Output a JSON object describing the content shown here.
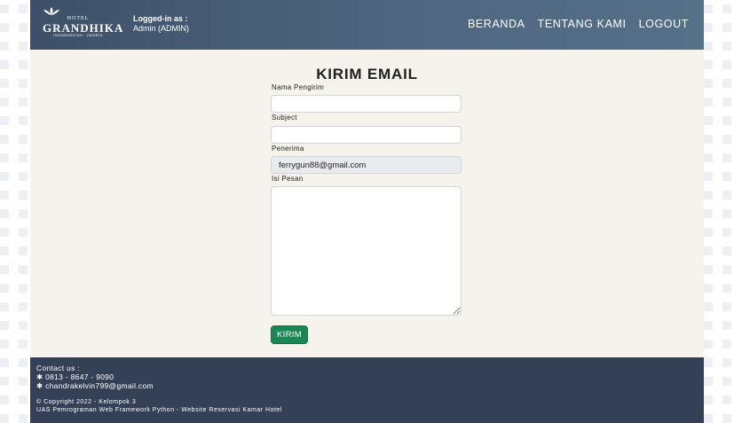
{
  "header": {
    "logo": {
      "hotel": "HOTEL",
      "name": "GRANDHIKA",
      "city": "ISKANDARSYAH · JAKARTA"
    },
    "login_label": "Logged-in as :",
    "login_user": "Admin (ADMIN)",
    "nav": [
      "BERANDA",
      "TENTANG KAMI",
      "LOGOUT"
    ]
  },
  "form": {
    "title": "KIRIM EMAIL",
    "sender_label": "Nama Pengirim",
    "sender_value": "",
    "subject_label": "Subject",
    "subject_value": "",
    "recipient_label": "Penerima",
    "recipient_value": "ferrygun88@gmail.com",
    "message_label": "Isi Pesan",
    "message_value": "",
    "submit_label": "KIRIM",
    "submit_color": "#198754"
  },
  "footer": {
    "contact_label": "Contact us :",
    "phone": "✱ 0813 - 8647 - 9090",
    "email": "✱ chandrakelvin799@gmail.com",
    "copyright": "© Copyright 2022 - Kelompok 3",
    "project": "UAS Pemrograman Web Framework Python - Website Reservasi Kamar Hotel"
  },
  "colors": {
    "header_bg": "#4f6680",
    "content_bg": "#f6f2ec",
    "footer_bg": "#344056"
  }
}
